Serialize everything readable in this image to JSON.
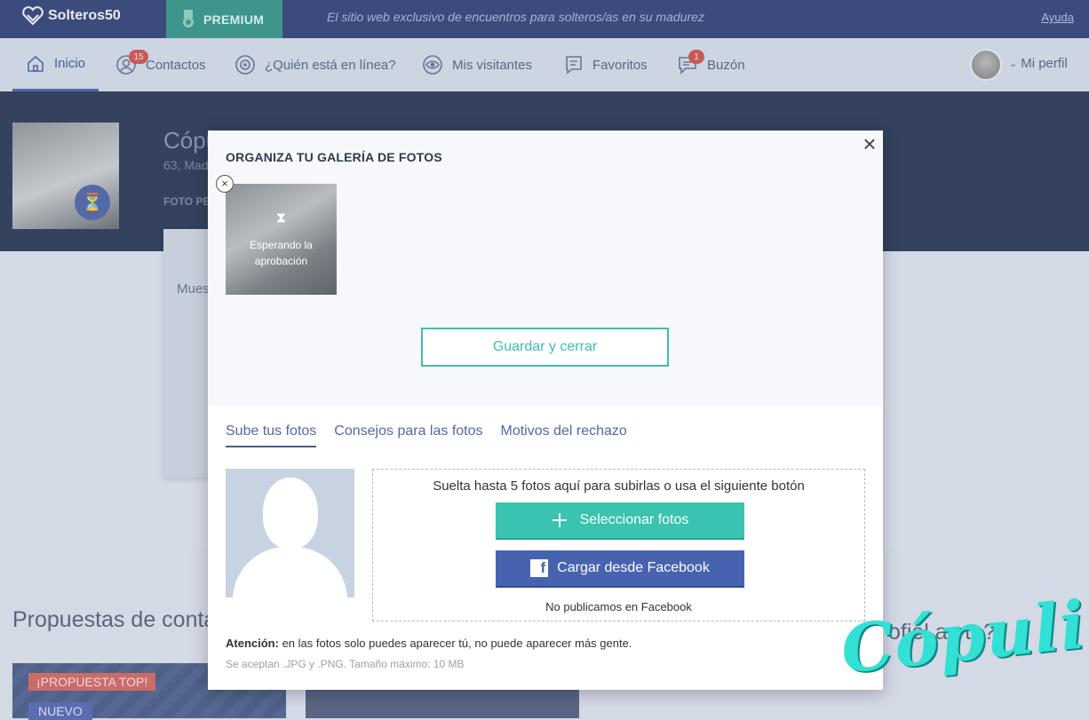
{
  "topbar": {
    "brand": "Solteros50",
    "premium_label": "PREMIUM",
    "tagline": "El sitio web exclusivo de encuentros para solteros/as en su madurez",
    "help_link": "Ayuda"
  },
  "nav": {
    "items": [
      {
        "label": "Inicio",
        "icon": "home-icon"
      },
      {
        "label": "Contactos",
        "icon": "contacts-icon",
        "badge": "15"
      },
      {
        "label": "¿Quién está en línea?",
        "icon": "online-icon"
      },
      {
        "label": "Mis visitantes",
        "icon": "eye-icon"
      },
      {
        "label": "Favoritos",
        "icon": "bookmark-icon"
      },
      {
        "label": "Buzón",
        "icon": "chat-icon",
        "badge": "1"
      }
    ],
    "profile_label": "Mi perfil"
  },
  "background": {
    "profile_name": "Cópu",
    "profile_meta": "63, Mad",
    "profile_tab": "FOTO PE",
    "card_text": "Mues",
    "section_heading": "Propuestas de conta",
    "tag_top": "¡PROPUESTA TOP!",
    "tag_new": "NUEVO",
    "right_text": "ofiel ay ta?"
  },
  "modal": {
    "title": "ORGANIZA TU GALERÍA DE FOTOS",
    "close_label": "×",
    "photo_status": "Esperando la aprobación",
    "save_button": "Guardar y cerrar",
    "tabs": [
      "Sube tus fotos",
      "Consejos para las fotos",
      "Motivos del rechazo"
    ],
    "dropzone_text": "Suelta hasta 5 fotos aquí para subirlas o usa el siguiente botón",
    "select_button": "Seleccionar fotos",
    "facebook_button": "Cargar desde Facebook",
    "facebook_note": "No publicamos en Facebook",
    "warning_label": "Atención:",
    "warning_text": " en las fotos solo puedes aparecer tú, no puede aparecer más gente.",
    "formats_text": "Se aceptan .JPG y .PNG.  Tamaño máximo: 10 MB"
  },
  "watermark": "Cópuli",
  "colors": {
    "accent_teal": "#39c3b0",
    "facebook_blue": "#4763b0",
    "topbar": "#3c4a7c"
  }
}
